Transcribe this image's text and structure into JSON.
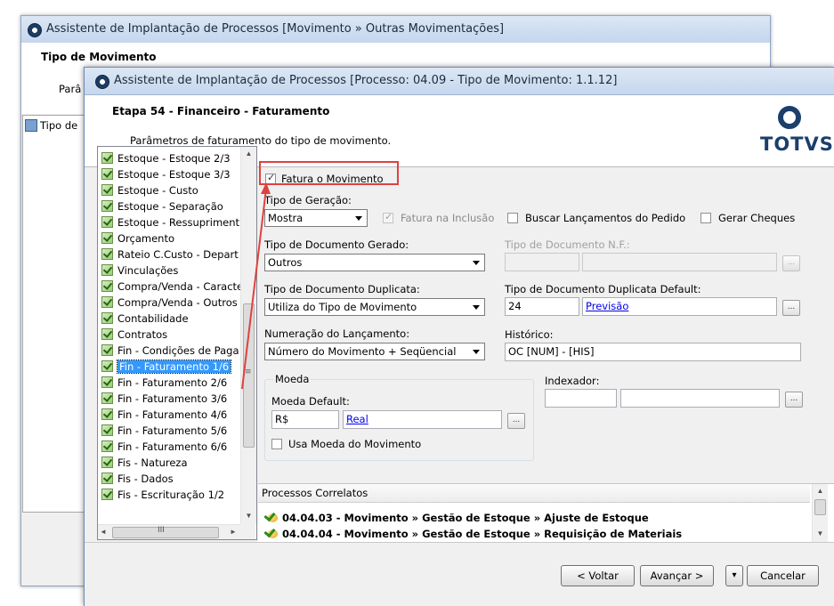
{
  "back_window": {
    "title": "Assistente de Implantação de Processos [Movimento » Outras Movimentações]",
    "heading": "Tipo de Movimento",
    "subtext_partial": "Parâ",
    "list_item_partial": "Tipo de"
  },
  "window": {
    "title": "Assistente de Implantação de Processos [Processo: 04.09 - Tipo de Movimento: 1.1.12]",
    "step_title": "Etapa 54 - Financeiro - Faturamento",
    "step_description": "Parâmetros de faturamento do tipo de movimento.",
    "logo_text": "TOTVS"
  },
  "steps": [
    {
      "label": "Estoque - Estoque 2/3",
      "checked": true
    },
    {
      "label": "Estoque - Estoque 3/3",
      "checked": true
    },
    {
      "label": "Estoque - Custo",
      "checked": true
    },
    {
      "label": "Estoque - Separação",
      "checked": true
    },
    {
      "label": "Estoque - Ressupriment",
      "checked": true
    },
    {
      "label": "Orçamento",
      "checked": true
    },
    {
      "label": "Rateio C.Custo - Depart",
      "checked": true
    },
    {
      "label": "Vinculações",
      "checked": true
    },
    {
      "label": "Compra/Venda - Caracte",
      "checked": true
    },
    {
      "label": "Compra/Venda - Outros",
      "checked": true
    },
    {
      "label": "Contabilidade",
      "checked": true
    },
    {
      "label": "Contratos",
      "checked": true
    },
    {
      "label": "Fin - Condições de Paga",
      "checked": true
    },
    {
      "label": "Fin - Faturamento 1/6",
      "checked": true,
      "selected": true
    },
    {
      "label": "Fin - Faturamento 2/6",
      "checked": true
    },
    {
      "label": "Fin - Faturamento 3/6",
      "checked": true
    },
    {
      "label": "Fin - Faturamento 4/6",
      "checked": true
    },
    {
      "label": "Fin - Faturamento 5/6",
      "checked": true
    },
    {
      "label": "Fin - Faturamento 6/6",
      "checked": true
    },
    {
      "label": "Fis - Natureza",
      "checked": true
    },
    {
      "label": "Fis - Dados",
      "checked": true
    },
    {
      "label": "Fis - Escrituração 1/2",
      "checked": true
    }
  ],
  "form": {
    "fatura_movimento": {
      "label": "Fatura o Movimento",
      "checked": true
    },
    "tipo_geracao": {
      "label": "Tipo de Geração:",
      "value": "Mostra"
    },
    "fatura_inclusao": {
      "label": "Fatura na Inclusão",
      "checked": true,
      "disabled": true
    },
    "buscar_lancamentos": {
      "label": "Buscar Lançamentos do Pedido",
      "checked": false
    },
    "gerar_cheques": {
      "label": "Gerar Cheques",
      "checked": false
    },
    "tipo_doc_gerado": {
      "label": "Tipo de Documento Gerado:",
      "value": "Outros"
    },
    "tipo_doc_nf": {
      "label": "Tipo de Documento N.F.:",
      "code": "",
      "description": ""
    },
    "tipo_doc_duplicata": {
      "label": "Tipo de Documento Duplicata:",
      "value": "Utiliza do Tipo de Movimento"
    },
    "tipo_doc_dup_default": {
      "label": "Tipo de Documento Duplicata Default:",
      "code": "24",
      "description": "Previsão"
    },
    "numeracao": {
      "label": "Numeração do Lançamento:",
      "value": "Número do Movimento + Seqüencial"
    },
    "historico": {
      "label": "Histórico:",
      "value": "OC [NUM] - [HIS]"
    },
    "moeda_group": {
      "label": "Moeda"
    },
    "moeda_default": {
      "label": "Moeda Default:",
      "code": "R$",
      "description": "Real"
    },
    "usa_moeda_movimento": {
      "label": "Usa Moeda do Movimento",
      "checked": false
    },
    "indexador": {
      "label": "Indexador:",
      "code": "",
      "description": ""
    },
    "lookup_button": "..."
  },
  "processos": {
    "header": "Processos Correlatos",
    "items": [
      "04.04.03 - Movimento » Gestão de Estoque » Ajuste de Estoque",
      "04.04.04 - Movimento » Gestão de Estoque » Requisição de Materiais"
    ]
  },
  "buttons": {
    "back": "< Voltar",
    "next": "Avançar >",
    "menu": "▾",
    "cancel": "Cancelar"
  },
  "scroll": {
    "up": "▲",
    "down": "▼",
    "left": "◄",
    "right": "►",
    "grip": "≡",
    "hgrip": "III"
  },
  "colors": {
    "highlight_border": "#e0413f",
    "selection": "#3399ff",
    "logo": "#1b3f6a",
    "link": "#0000ee"
  }
}
